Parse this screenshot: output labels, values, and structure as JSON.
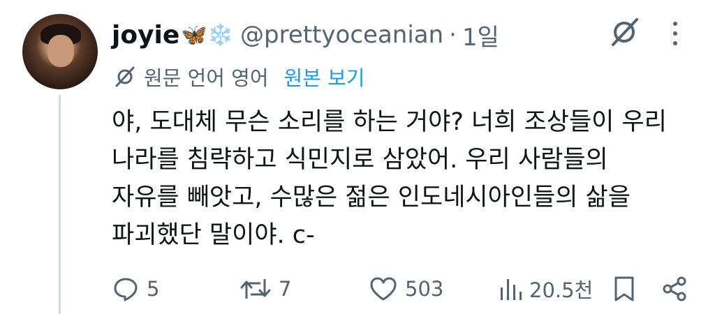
{
  "author": {
    "name": "joyie",
    "emoji": "🦋❄️",
    "handle": "@prettyoceanian",
    "separator": "·",
    "time": "1일"
  },
  "translation": {
    "label": "원문 언어 영어",
    "show_original": "원본 보기"
  },
  "tweet": {
    "text": "야, 도대체 무슨 소리를 하는 거야? 너희 조상들이 우리\n나라를 침략하고 식민지로 삼았어. 우리 사람들의\n자유를 빼앗고, 수많은 젊은 인도네시아인들의 삶을\n파괴했단 말이야. c-"
  },
  "actions": {
    "replies": "5",
    "reposts": "7",
    "likes": "503",
    "views": "20.5천"
  },
  "colors": {
    "text": "#0f1419",
    "muted": "#536471",
    "link": "#1d9bf0",
    "thread_line": "#cfd9de"
  },
  "icons": [
    "grok-icon",
    "more-icon",
    "translate-icon",
    "reply-icon",
    "repost-icon",
    "like-icon",
    "views-icon",
    "bookmark-icon",
    "share-icon"
  ]
}
